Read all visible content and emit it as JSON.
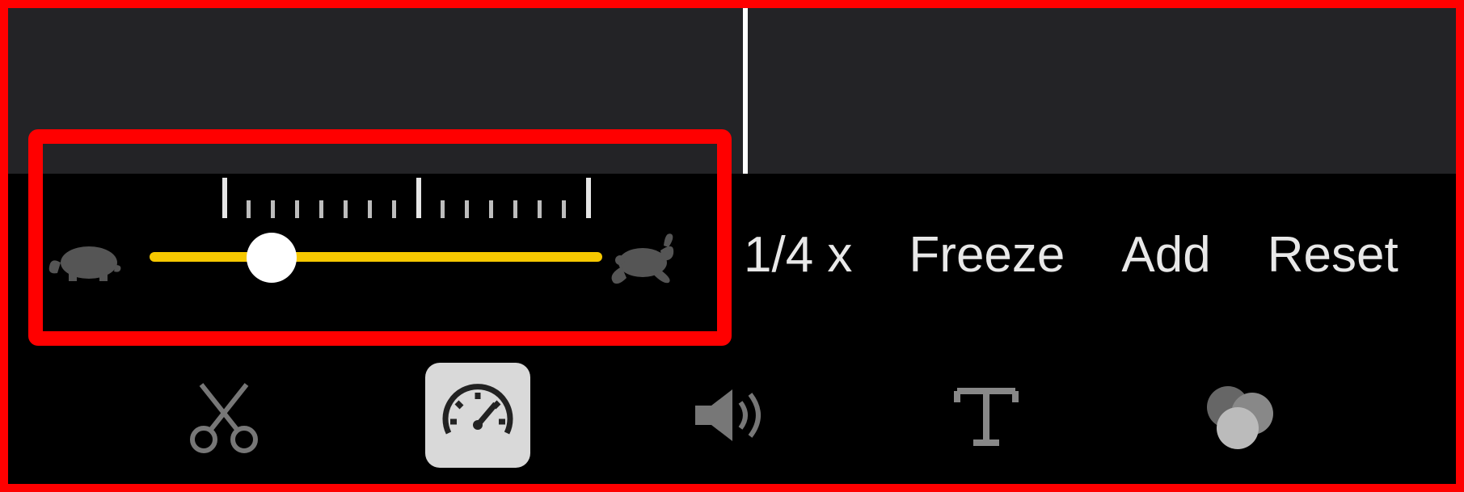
{
  "speed": {
    "slider_percent": 22,
    "current_label": "1/4 x",
    "freeze_label": "Freeze",
    "add_label": "Add",
    "reset_label": "Reset"
  },
  "toolbar": {
    "cut": "cut",
    "speed": "speed",
    "volume": "volume",
    "text": "text",
    "filters": "filters",
    "selected": "speed"
  }
}
